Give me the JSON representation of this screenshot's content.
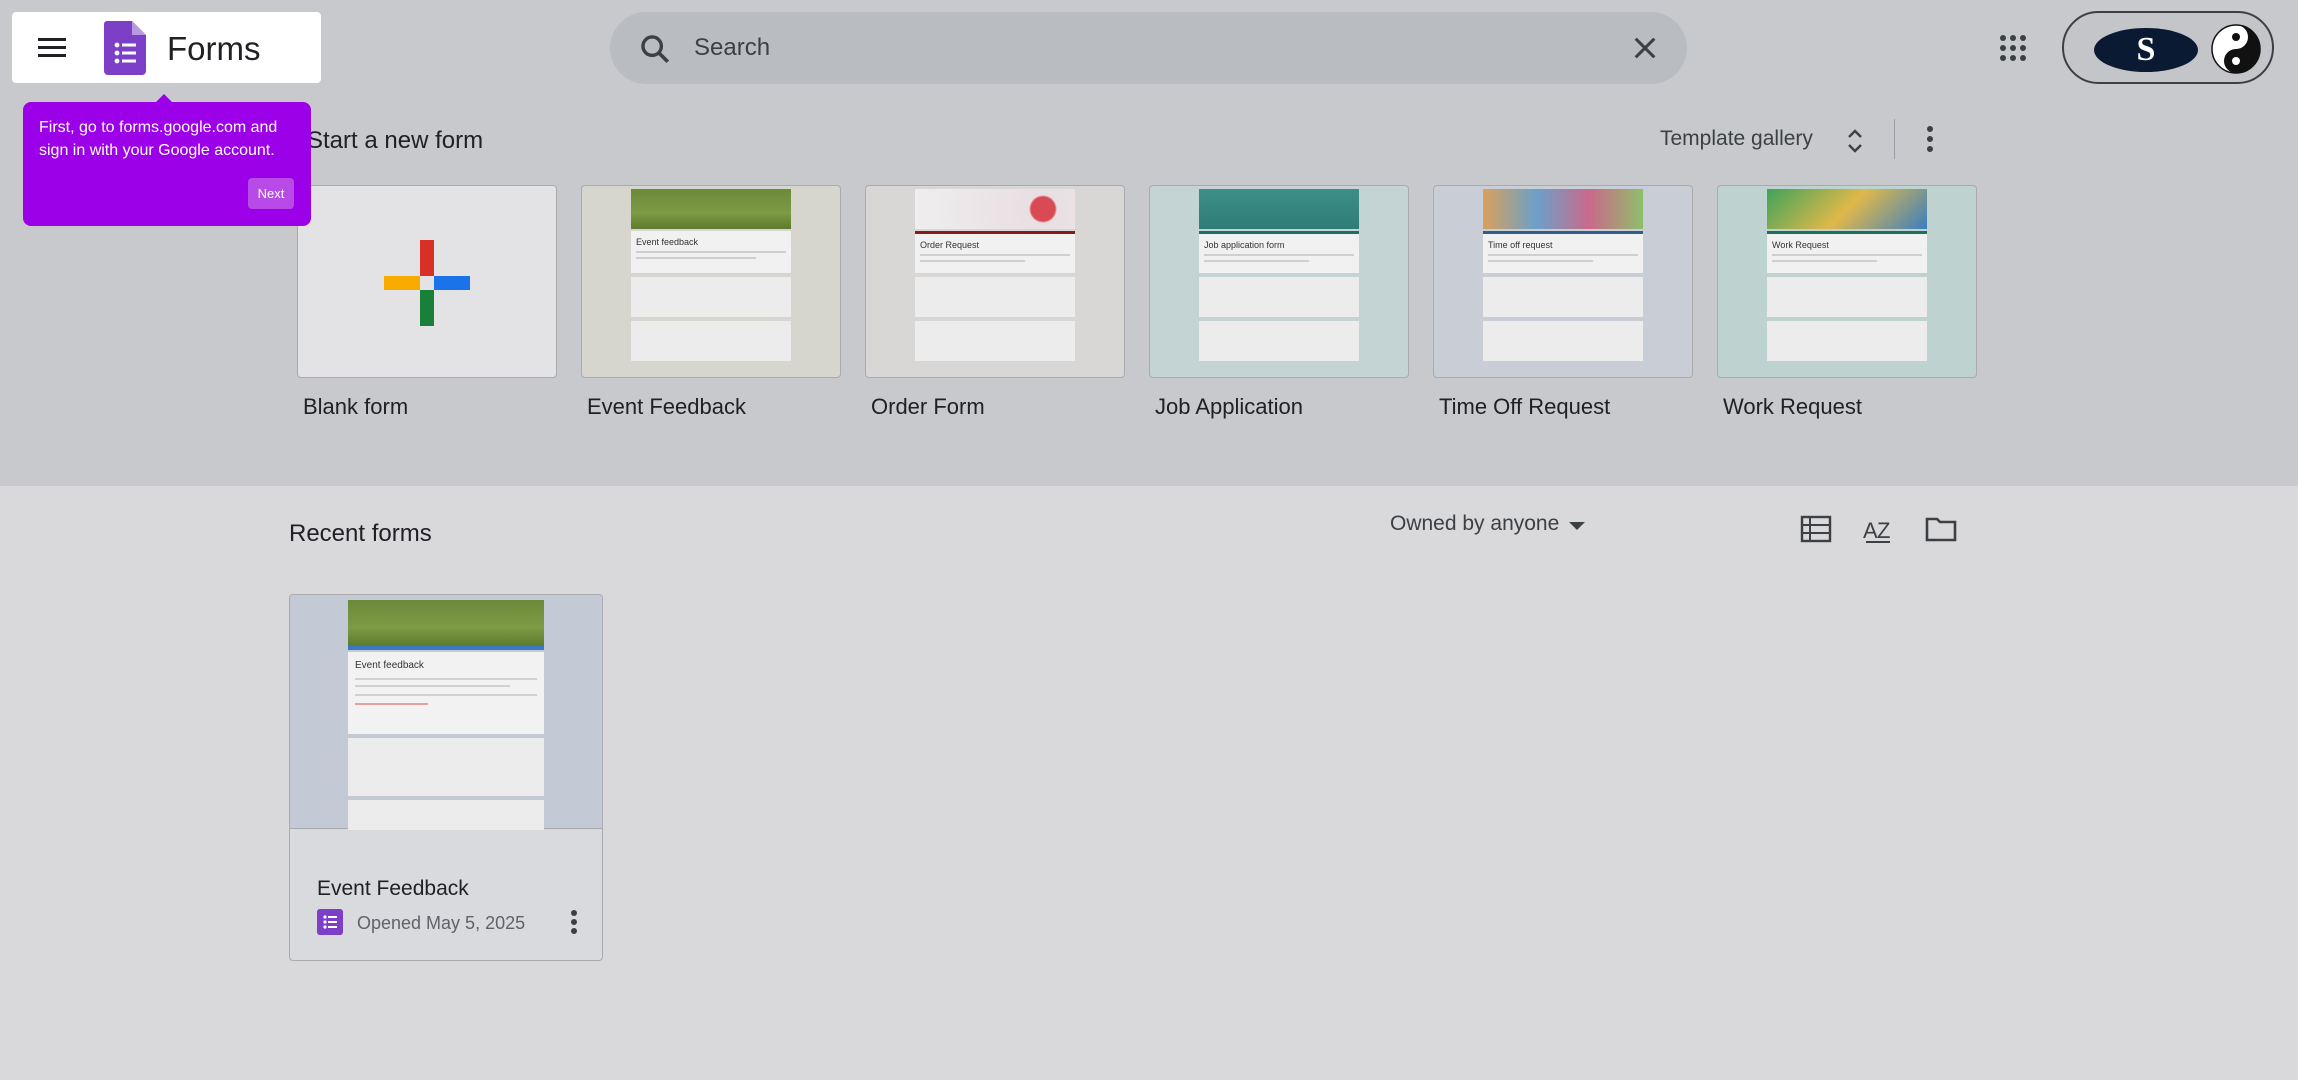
{
  "header": {
    "brand_name": "Forms",
    "search_placeholder": "Search"
  },
  "tooltip": {
    "text": "First, go to forms.google.com and sign in with your Google account.",
    "next_label": "Next"
  },
  "templates": {
    "title": "Start a new form",
    "gallery_label": "Template gallery",
    "items": [
      {
        "name": "Blank form",
        "icon": "plus-icon"
      },
      {
        "name": "Event Feedback",
        "preview_title": "Event feedback"
      },
      {
        "name": "Order Form",
        "preview_title": "Order Request"
      },
      {
        "name": "Job Application",
        "preview_title": "Job application form"
      },
      {
        "name": "Time Off Request",
        "preview_title": "Time off request"
      },
      {
        "name": "Work Request",
        "preview_title": "Work Request"
      }
    ]
  },
  "recent": {
    "title": "Recent forms",
    "filter_label": "Owned by anyone",
    "forms": [
      {
        "name": "Event Feedback",
        "opened": "Opened May 5, 2025",
        "preview_title": "Event feedback"
      }
    ]
  },
  "colors": {
    "forms_purple": "#7e3fc8",
    "tooltip_purple": "#9c00e8"
  }
}
